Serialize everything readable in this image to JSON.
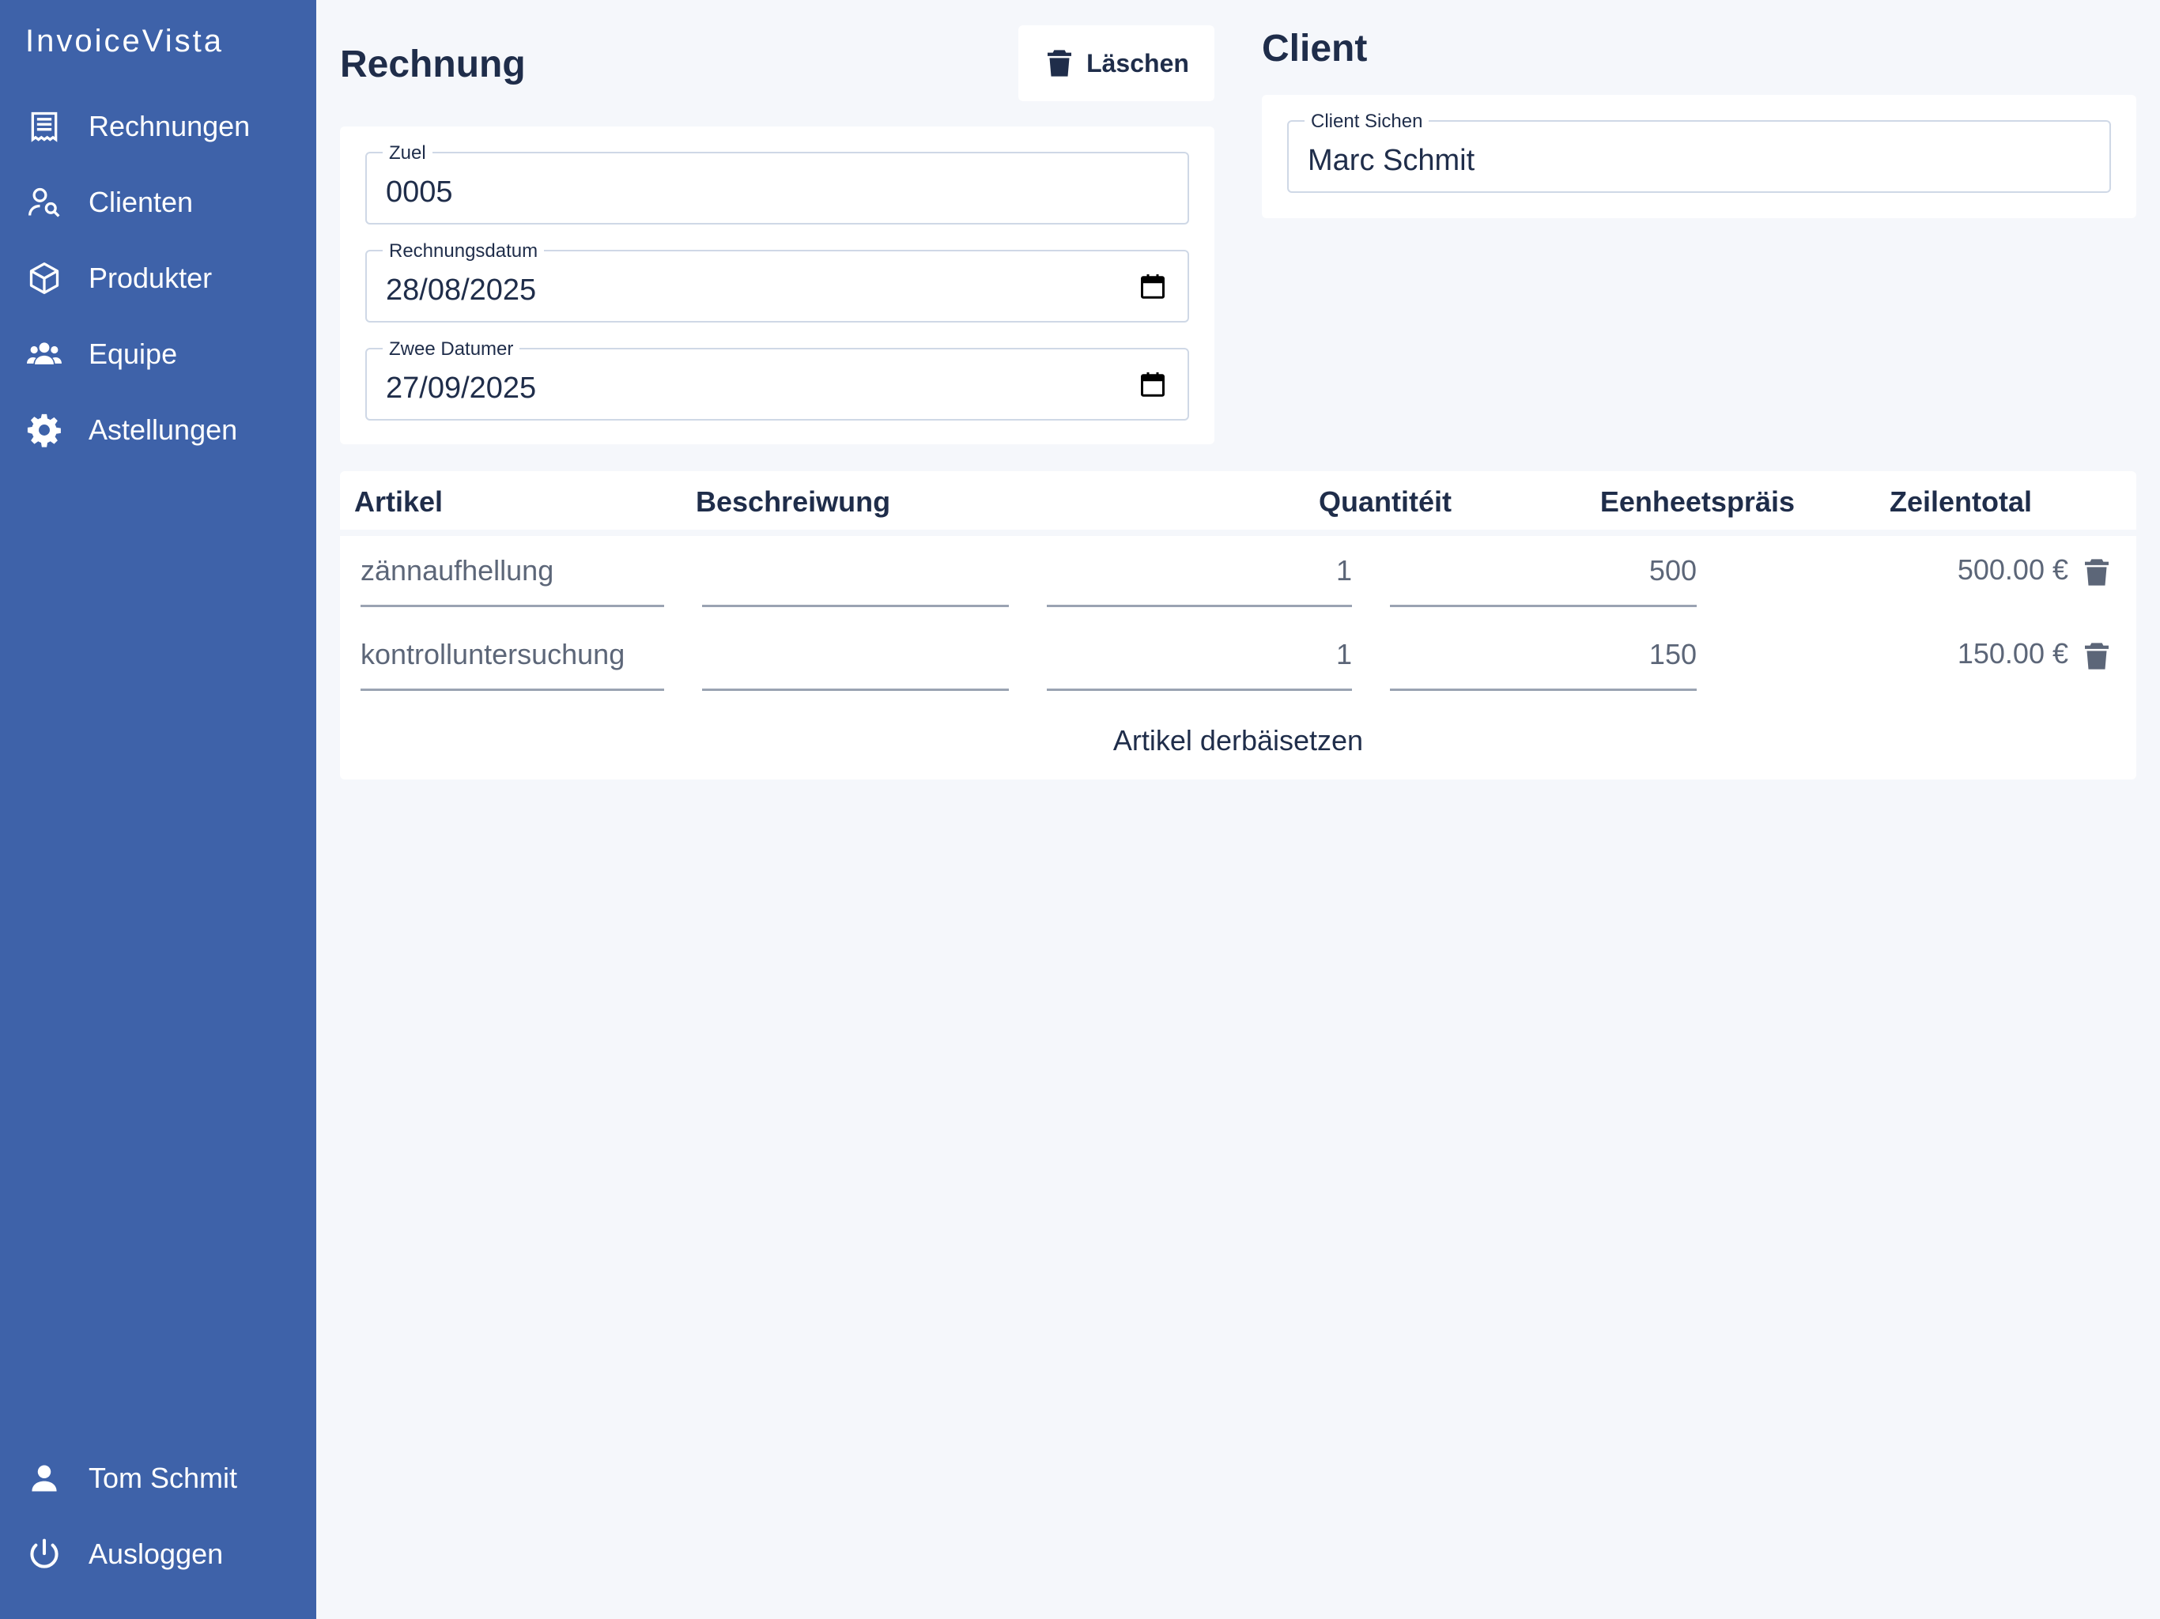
{
  "app": {
    "brand": "InvoiceVista"
  },
  "sidebar": {
    "items": [
      {
        "label": "Rechnungen",
        "icon": "receipt-icon"
      },
      {
        "label": "Clienten",
        "icon": "user-search-icon"
      },
      {
        "label": "Produkter",
        "icon": "cube-icon"
      },
      {
        "label": "Equipe",
        "icon": "team-icon"
      },
      {
        "label": "Astellungen",
        "icon": "gear-icon"
      }
    ],
    "bottom": [
      {
        "label": "Tom Schmit",
        "icon": "person-icon"
      },
      {
        "label": "Ausloggen",
        "icon": "power-icon"
      }
    ]
  },
  "invoice": {
    "title": "Rechnung",
    "delete_label": "Läschen",
    "fields": {
      "number": {
        "label": "Zuel",
        "value": "0005"
      },
      "date": {
        "label": "Rechnungsdatum",
        "value": "28/08/2025"
      },
      "due": {
        "label": "Zwee Datumer",
        "value": "27/09/2025"
      }
    }
  },
  "client": {
    "title": "Client",
    "search": {
      "label": "Client Sichen",
      "value": "Marc Schmit"
    }
  },
  "table": {
    "headers": {
      "article": "Artikel",
      "description": "Beschreiwung",
      "quantity": "Quantitéit",
      "unit_price": "Eenheetspräis",
      "line_total": "Zeilentotal"
    },
    "rows": [
      {
        "article": "zännaufhellung",
        "description": "",
        "quantity": "1",
        "unit_price": "500",
        "total": "500.00 €"
      },
      {
        "article": "kontrolluntersuchung",
        "description": "",
        "quantity": "1",
        "unit_price": "150",
        "total": "150.00 €"
      }
    ],
    "add_label": "Artikel derbäisetzen"
  },
  "colors": {
    "sidebar": "#3e62a9",
    "background": "#f5f7fb",
    "text": "#1f2d4a",
    "muted": "#5c6678"
  }
}
